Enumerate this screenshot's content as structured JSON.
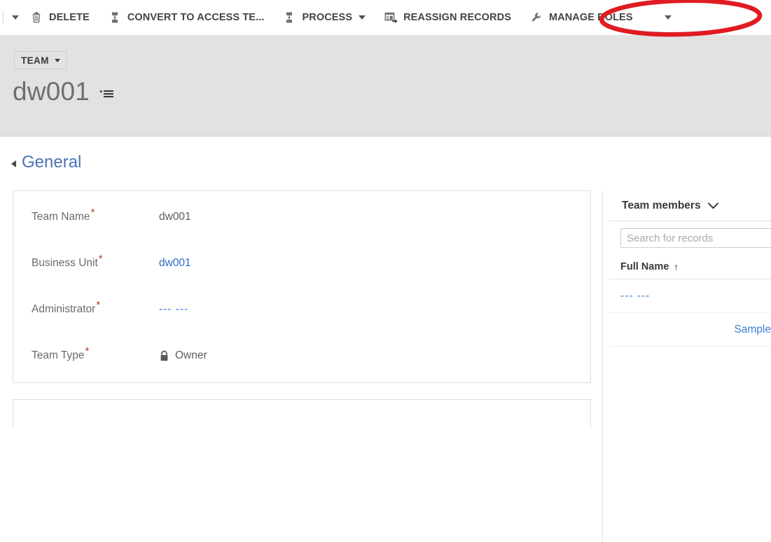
{
  "command_bar": {
    "overflow_caret": "chevron-down",
    "buttons": [
      {
        "label": "DELETE",
        "icon": "trash-icon",
        "has_caret": false
      },
      {
        "label": "CONVERT TO ACCESS TE...",
        "icon": "hierarchy-icon",
        "has_caret": false
      },
      {
        "label": "PROCESS",
        "icon": "hierarchy-icon",
        "has_caret": true
      },
      {
        "label": "REASSIGN RECORDS",
        "icon": "reassign-records-icon",
        "has_caret": false
      },
      {
        "label": "MANAGE ROLES",
        "icon": "wrench-icon",
        "has_caret": false
      }
    ]
  },
  "record_header": {
    "entity_type": "TEAM",
    "entity_type_caret": "caret-down",
    "title": "dw001",
    "form_selector_icon": "form-selector-icon"
  },
  "section": {
    "title": "General",
    "collapse_icon": "collapse-triangle"
  },
  "fields": [
    {
      "label": "Team Name",
      "required": true,
      "value": "dw001",
      "style": "text"
    },
    {
      "label": "Business Unit",
      "required": true,
      "value": "dw001",
      "style": "link"
    },
    {
      "label": "Administrator",
      "required": true,
      "value": "--- ---",
      "style": "link-dash"
    },
    {
      "label": "Team Type",
      "required": true,
      "value": "Owner",
      "style": "locked",
      "icon": "lock-icon"
    }
  ],
  "subgrid": {
    "title": "Team members",
    "expand_icon": "chevron-down-icon",
    "search": {
      "placeholder": "Search for records",
      "value": ""
    },
    "column_header": {
      "label": "Full Name",
      "sort_indicator": "↑"
    },
    "rows": [
      {
        "value": "--- ---",
        "style": "dash"
      },
      {
        "value": "Sample",
        "style": "plain"
      }
    ]
  },
  "annotation": {
    "shape": "ellipse",
    "color": "#e01b22",
    "targets": "MANAGE ROLES"
  },
  "colors": {
    "header_band": "#e2e2e2",
    "section_title": "#4a72b5",
    "link": "#2d6bc4",
    "required_star": "#c0392b",
    "annotation_red": "#e01b22"
  }
}
